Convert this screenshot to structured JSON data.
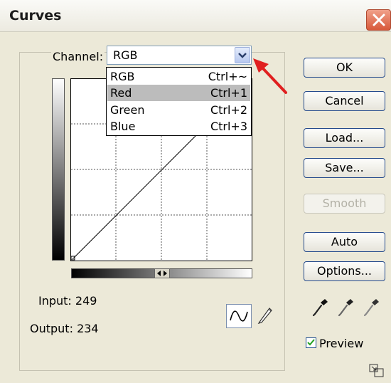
{
  "window": {
    "title": "Curves"
  },
  "channel": {
    "label": "Channel:",
    "selected": "RGB",
    "options": [
      {
        "name": "RGB",
        "shortcut": "Ctrl+~"
      },
      {
        "name": "Red",
        "shortcut": "Ctrl+1"
      },
      {
        "name": "Green",
        "shortcut": "Ctrl+2"
      },
      {
        "name": "Blue",
        "shortcut": "Ctrl+3"
      }
    ],
    "highlighted_option": "Red"
  },
  "readouts": {
    "input_label": "Input:",
    "input_value": "249",
    "output_label": "Output:",
    "output_value": "234"
  },
  "buttons": {
    "ok": "OK",
    "cancel": "Cancel",
    "load": "Load...",
    "save": "Save...",
    "smooth": "Smooth",
    "auto": "Auto",
    "options": "Options..."
  },
  "preview": {
    "label": "Preview",
    "checked": true
  },
  "colors": {
    "annotation_arrow": "#e02020",
    "button_border": "#244a8c"
  }
}
